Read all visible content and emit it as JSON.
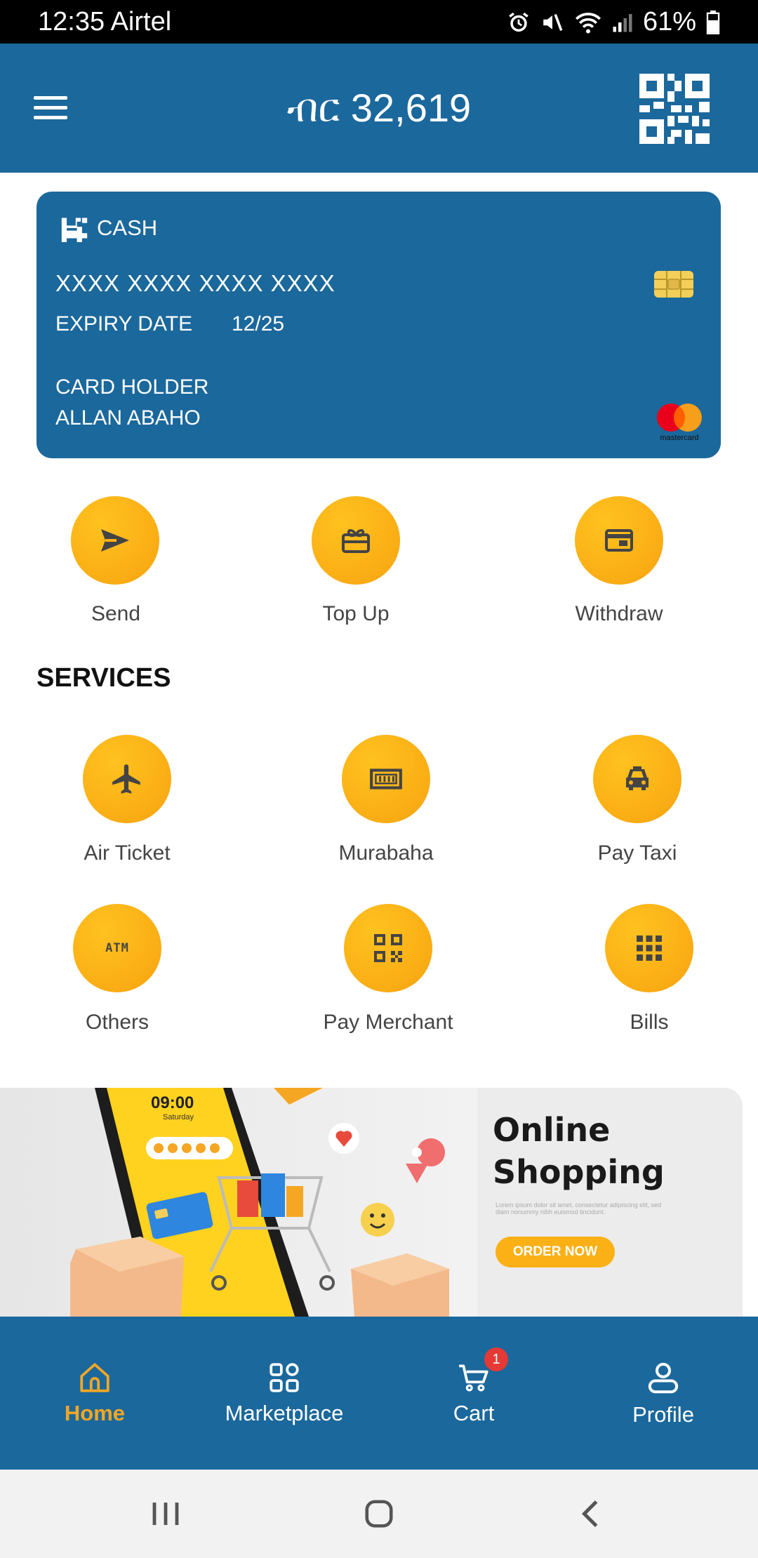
{
  "status_bar": {
    "time": "12:35",
    "carrier": "Airtel",
    "battery": "61%"
  },
  "header": {
    "balance": "ብር 32,619"
  },
  "card": {
    "brand": "CASH",
    "number": "XXXX XXXX XXXX XXXX",
    "expiry_label": "EXPIRY DATE",
    "expiry_value": "12/25",
    "holder_label": "CARD HOLDER",
    "holder_name": "ALLAN ABAHO",
    "network_logo_text": "mastercard"
  },
  "actions": [
    {
      "label": "Send",
      "icon": "send-icon"
    },
    {
      "label": "Top Up",
      "icon": "gift-card-icon"
    },
    {
      "label": "Withdraw",
      "icon": "wallet-card-icon"
    }
  ],
  "services": {
    "title": "SERVICES",
    "items": [
      {
        "label": "Air Ticket",
        "icon": "airplane-icon"
      },
      {
        "label": "Murabaha",
        "icon": "cash-note-icon"
      },
      {
        "label": "Pay Taxi",
        "icon": "taxi-icon"
      },
      {
        "label": "Others",
        "icon": "atm-icon",
        "icon_text": "ATM"
      },
      {
        "label": "Pay Merchant",
        "icon": "qr-code-icon"
      },
      {
        "label": "Bills",
        "icon": "grid-icon"
      }
    ]
  },
  "banner": {
    "phone_time": "09:00",
    "phone_day": "Saturday",
    "title_line1": "Online",
    "title_line2": "Shopping",
    "subtitle": "Lorem ipsum dolor sit amet, consectetur adipiscing elit, sed diam nonummy nibh euismod tincidunt.",
    "cta": "ORDER NOW"
  },
  "bottom_nav": {
    "items": [
      {
        "label": "Home",
        "icon": "home-icon",
        "active": true
      },
      {
        "label": "Marketplace",
        "icon": "apps-icon"
      },
      {
        "label": "Cart",
        "icon": "cart-icon",
        "badge": "1"
      },
      {
        "label": "Profile",
        "icon": "user-icon"
      }
    ]
  },
  "colors": {
    "primary": "#1b689c",
    "accent": "#fbb016",
    "active_nav": "#f5a623",
    "badge": "#e53935"
  }
}
